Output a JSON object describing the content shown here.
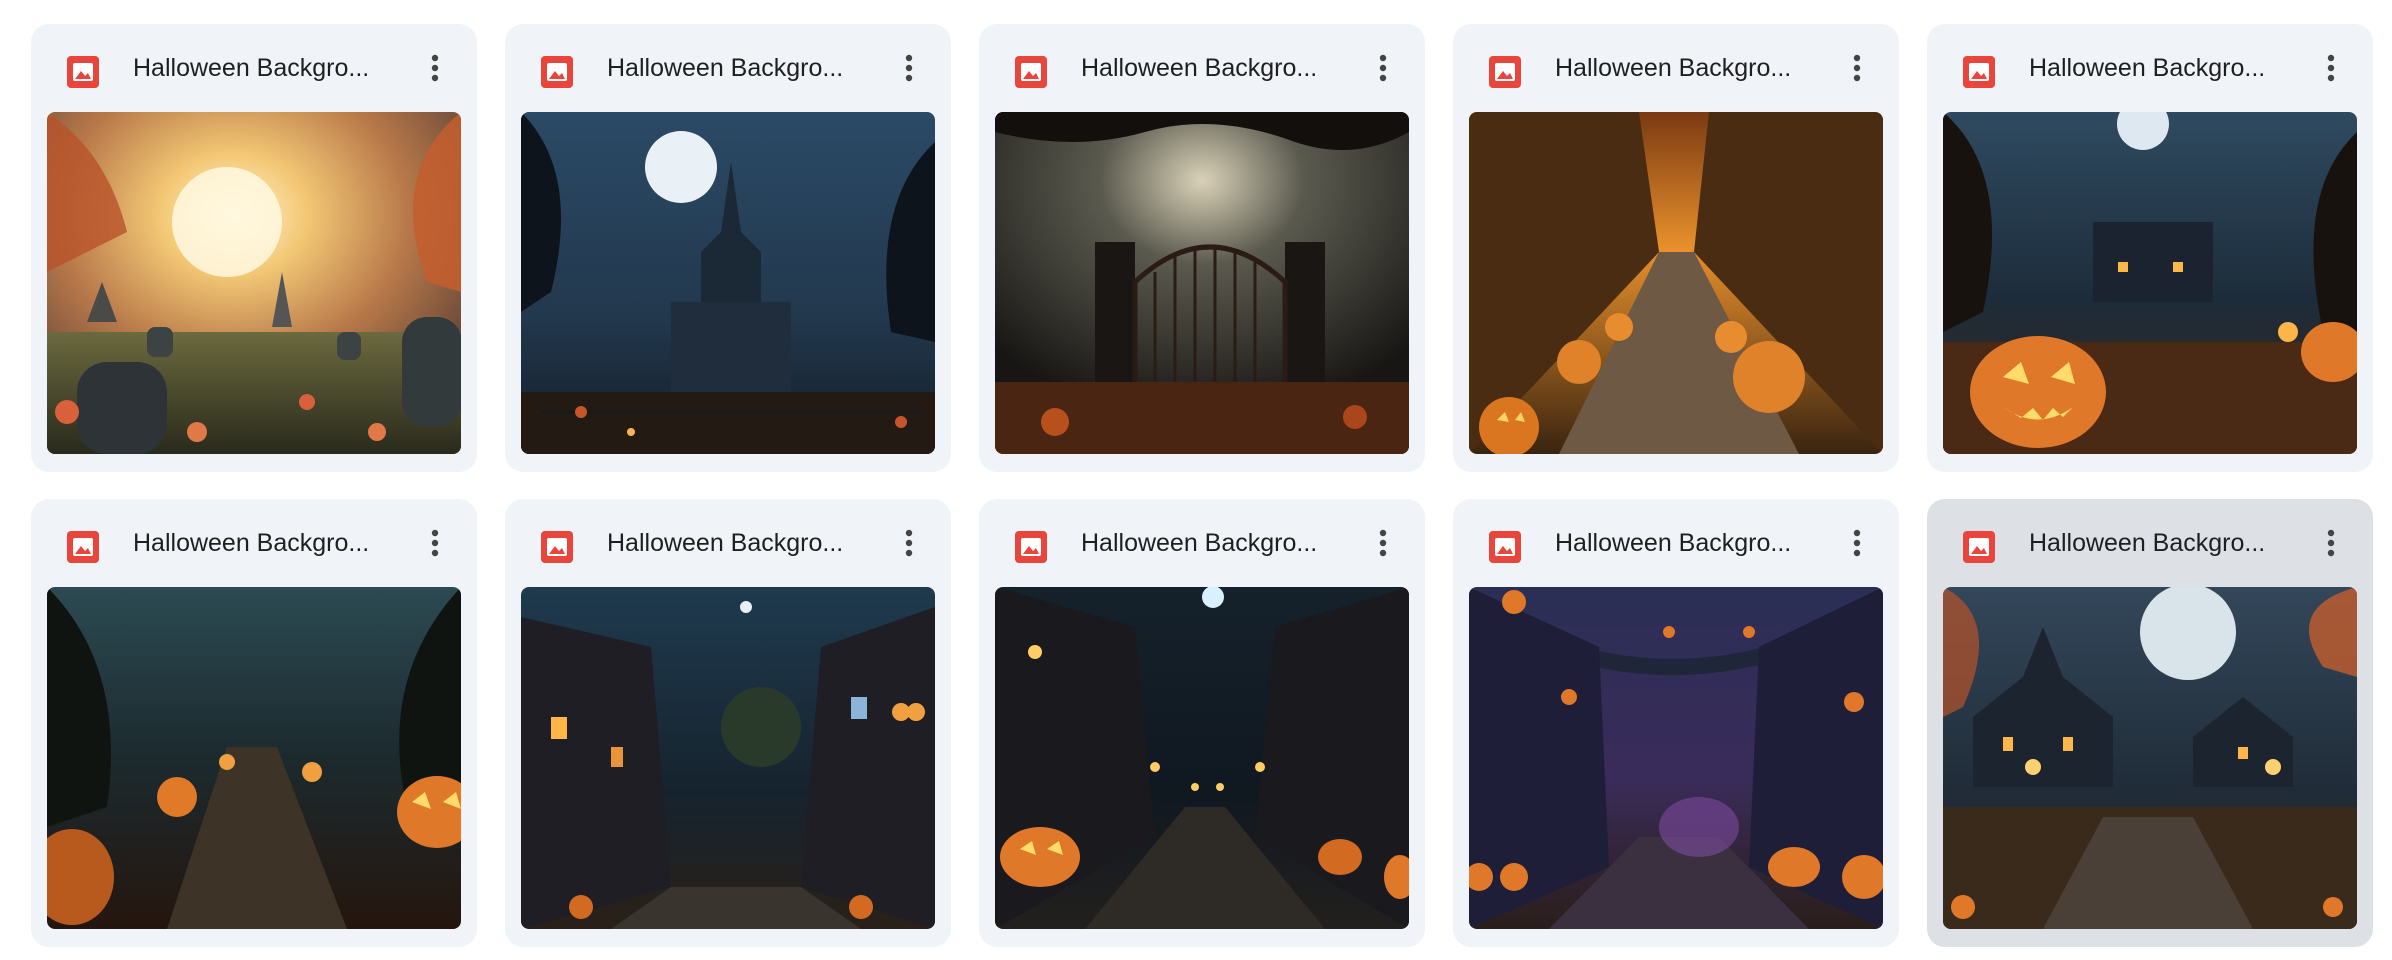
{
  "files": [
    {
      "name": "Halloween Backgro...",
      "icon": "image-file-icon",
      "thumbnail": "graveyard-sunset-scene"
    },
    {
      "name": "Halloween Backgro...",
      "icon": "image-file-icon",
      "thumbnail": "haunted-castle-moon-scene"
    },
    {
      "name": "Halloween Backgro...",
      "icon": "image-file-icon",
      "thumbnail": "iron-gate-moon-scene"
    },
    {
      "name": "Halloween Backgro...",
      "icon": "image-file-icon",
      "thumbnail": "cornfield-pumpkin-path-scene"
    },
    {
      "name": "Halloween Backgro...",
      "icon": "image-file-icon",
      "thumbnail": "jack-o-lantern-mansion-scene"
    },
    {
      "name": "Halloween Backgro...",
      "icon": "image-file-icon",
      "thumbnail": "dark-forest-pumpkins-scene"
    },
    {
      "name": "Halloween Backgro...",
      "icon": "image-file-icon",
      "thumbnail": "night-street-houses-scene"
    },
    {
      "name": "Halloween Backgro...",
      "icon": "image-file-icon",
      "thumbnail": "cobblestone-street-moon-scene"
    },
    {
      "name": "Halloween Backgro...",
      "icon": "image-file-icon",
      "thumbnail": "purple-street-garland-scene"
    },
    {
      "name": "Halloween Backgro...",
      "icon": "image-file-icon",
      "thumbnail": "haunted-village-moon-scene"
    }
  ],
  "more_actions_icon": "more-vert-icon",
  "colors": {
    "card_bg": "#f0f4f9",
    "card_selected_bg": "#dde1e6",
    "file_icon": "#e8453c",
    "text": "#1f1f1f"
  }
}
